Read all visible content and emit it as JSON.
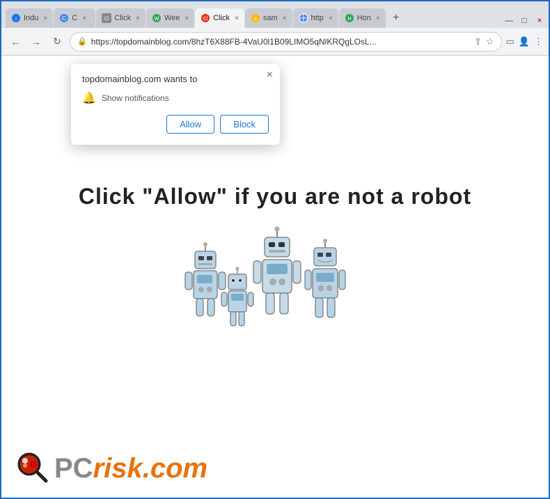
{
  "browser": {
    "tabs": [
      {
        "id": "tab1",
        "label": "Indu",
        "active": false,
        "favicon": "industry"
      },
      {
        "id": "tab2",
        "label": "C",
        "active": false,
        "favicon": "browser"
      },
      {
        "id": "tab3",
        "label": "Click",
        "active": false,
        "favicon": "click"
      },
      {
        "id": "tab4",
        "label": "Wee",
        "active": false,
        "favicon": "weekly"
      },
      {
        "id": "tab5",
        "label": "Click",
        "active": true,
        "favicon": "click2"
      },
      {
        "id": "tab6",
        "label": "sam",
        "active": false,
        "favicon": "search"
      },
      {
        "id": "tab7",
        "label": "http",
        "active": false,
        "favicon": "globe"
      },
      {
        "id": "tab8",
        "label": "Hon",
        "active": false,
        "favicon": "home"
      }
    ],
    "new_tab_label": "+",
    "address": "https://topdomainblog.com/8hzT6X88FB-4VaU0l1B09LIMO5qNlKRQgLOsL...",
    "window_controls": {
      "minimize": "—",
      "maximize": "□",
      "close": "×"
    }
  },
  "popup": {
    "title": "topdomainblog.com wants to",
    "close_label": "×",
    "permission_icon": "🔔",
    "permission_text": "Show notifications",
    "allow_label": "Allow",
    "block_label": "Block"
  },
  "page": {
    "captcha_text": "Click \"Allow\"   if you are not   a robot"
  },
  "pcrisk": {
    "text_gray": "PC",
    "text_orange": "risk.com"
  }
}
